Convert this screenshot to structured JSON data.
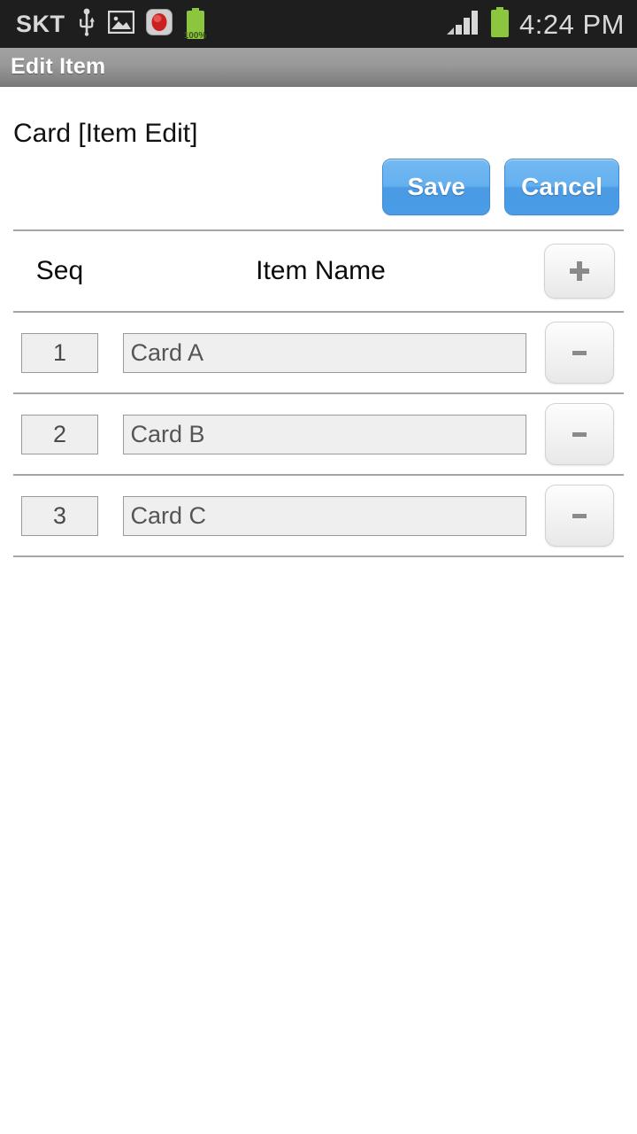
{
  "status_bar": {
    "carrier": "SKT",
    "battery_percent": "100%",
    "time": "4:24 PM",
    "icons": {
      "usb": "usb-icon",
      "gallery": "image-icon",
      "record": "record-icon",
      "battery_small": "battery-icon",
      "signal": "signal-bars-icon",
      "battery_main": "battery-icon"
    }
  },
  "title_bar": {
    "title": "Edit Item"
  },
  "page": {
    "heading": "Card [Item Edit]",
    "save_label": "Save",
    "cancel_label": "Cancel"
  },
  "table": {
    "headers": {
      "seq": "Seq",
      "item_name": "Item Name"
    },
    "add_label": "+",
    "remove_label": "-",
    "rows": [
      {
        "seq": "1",
        "name": "Card A",
        "remove_label": "-"
      },
      {
        "seq": "2",
        "name": "Card B",
        "remove_label": "-"
      },
      {
        "seq": "3",
        "name": "Card C",
        "remove_label": "-"
      }
    ]
  },
  "colors": {
    "accent_blue": "#4a9ae4",
    "status_bar_bg": "#1e1e1e",
    "title_bar_bg": "#999999",
    "battery_green": "#8cc63f",
    "record_red": "#cc1f1f",
    "divider": "#a6a6a6",
    "field_bg": "#efefef"
  }
}
